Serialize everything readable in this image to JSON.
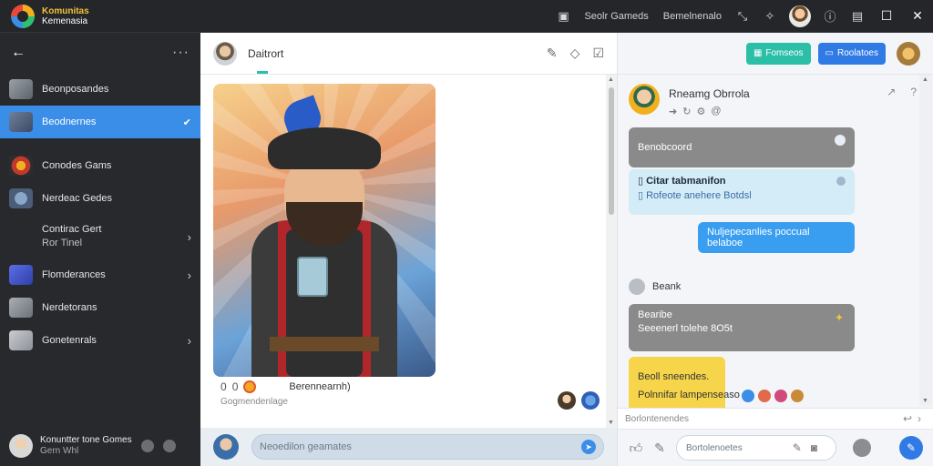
{
  "app": {
    "title": "Komunitas",
    "subtitle": "Kemenasia"
  },
  "topbar": {
    "links": [
      "Seolr Gameds",
      "Bemelnenalo"
    ]
  },
  "sidebar": {
    "items": [
      {
        "label": "Beonposandes"
      },
      {
        "label": "Beodnernes"
      },
      {
        "label": "Conodes Gams"
      },
      {
        "label": "Nerdeac Gedes"
      },
      {
        "label": "Contirac Gert",
        "sub": "Ror Tinel"
      },
      {
        "label": "Flomderances"
      },
      {
        "label": "Nerdetorans"
      },
      {
        "label": "Gonetenrals"
      }
    ],
    "footer": {
      "name": "Konuntter tone Gomes",
      "status": "Gern Whl"
    }
  },
  "middle": {
    "header_name": "Daitrort",
    "post": {
      "count": "0",
      "count2": "0",
      "action_label": "Berennearnh)",
      "caption": "Gogmendenlage"
    },
    "input_placeholder": "Neoedilon geamates"
  },
  "right": {
    "buttons": {
      "green": "Fomseos",
      "blue": "Roolatoes"
    },
    "contact_name": "Rneamg Obrrola",
    "messages": {
      "m1": "Benobcoord",
      "m2_title": "Citar tabmanifon",
      "m2_body": "Rofeote anehere Botdsl",
      "m3": "Nuljepecanlies poccual belaboe",
      "sender2": "Beank",
      "m4_title": "Bearibe",
      "m4_body": "Seeenerl tolehe 8O5t",
      "m5_title": "Beoll sneendes.",
      "m5_body": "Polnnifar lampenseaso"
    },
    "reply_placeholder": "Borlontenendes",
    "input_placeholder": "Bortolenoetes"
  }
}
